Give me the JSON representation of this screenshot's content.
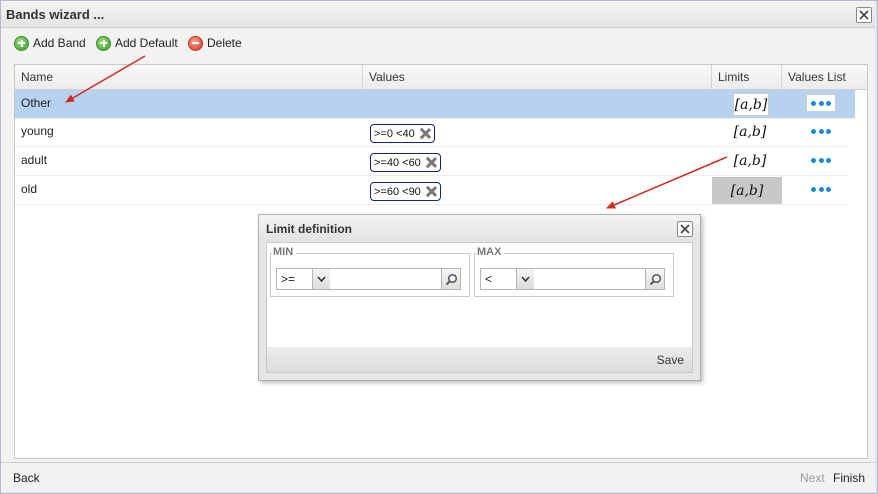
{
  "window": {
    "title": "Bands wizard ..."
  },
  "toolbar": {
    "add_band": "Add Band",
    "add_default": "Add Default",
    "delete": "Delete"
  },
  "grid": {
    "columns": {
      "name": "Name",
      "values": "Values",
      "limits": "Limits",
      "values_list": "Values List"
    },
    "rows": [
      {
        "name": "Other",
        "values": "",
        "limits": "[a,b]"
      },
      {
        "name": "young",
        "values": ">=0 <40",
        "limits": "[a,b]"
      },
      {
        "name": "adult",
        "values": ">=40 <60",
        "limits": "[a,b]"
      },
      {
        "name": "old",
        "values": ">=60 <90",
        "limits": "[a,b]"
      }
    ]
  },
  "footer": {
    "back": "Back",
    "next": "Next",
    "finish": "Finish"
  },
  "dialog": {
    "title": "Limit definition",
    "min": {
      "legend": "MIN",
      "operator": ">=",
      "value": ""
    },
    "max": {
      "legend": "MAX",
      "operator": "<",
      "value": ""
    },
    "save": "Save"
  },
  "colors": {
    "selected_row": "#b7d2ee",
    "tag_border": "#1a237e",
    "dots": "#1a8ad4",
    "arrow": "#d42a1f"
  }
}
